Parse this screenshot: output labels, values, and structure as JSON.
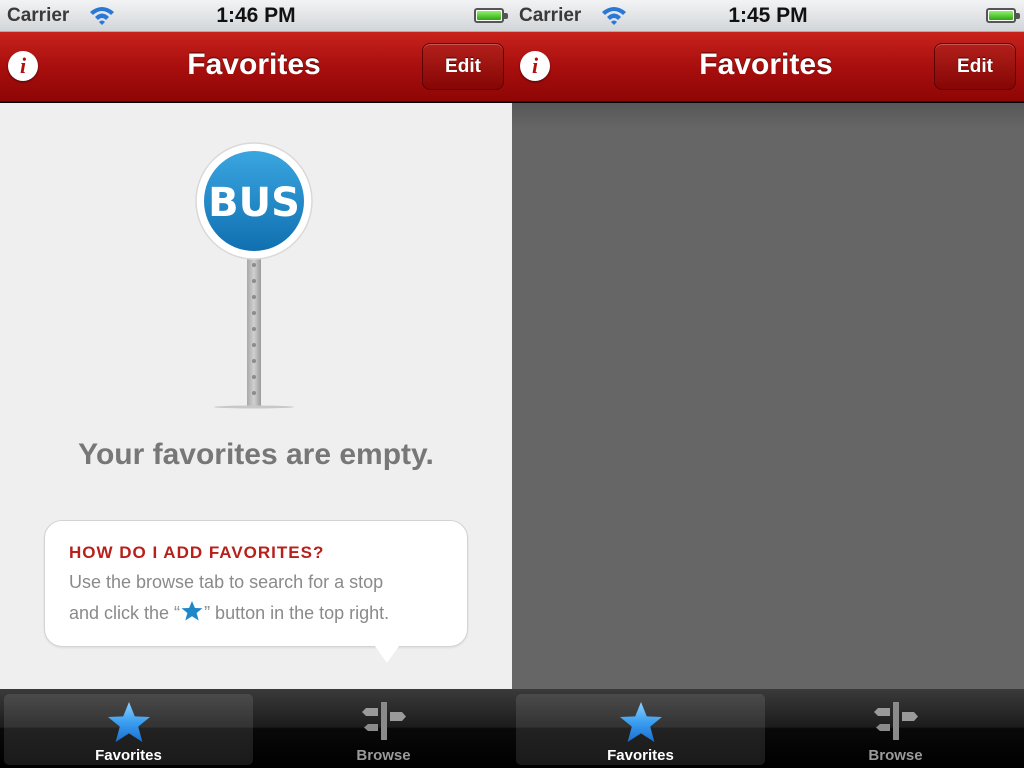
{
  "colors": {
    "navbar_red": "#a80f0e",
    "accent_red": "#b8201c",
    "bus_blue": "#1e8bc9",
    "star_blue": "#2a8fd8"
  },
  "screens": [
    {
      "status": {
        "carrier": "Carrier",
        "time": "1:46 PM"
      },
      "nav": {
        "title": "Favorites",
        "edit_label": "Edit",
        "info_icon": "info-icon"
      },
      "empty": {
        "sign_text": "BUS",
        "message": "Your favorites are empty.",
        "help_title": "HOW DO I ADD FAVORITES?",
        "help_line1": "Use the browse tab to search for a stop",
        "help_line2_before": "and click the “",
        "help_line2_after": "” button in the top right."
      },
      "tabs": [
        {
          "label": "Favorites",
          "icon": "star-icon",
          "selected": true
        },
        {
          "label": "Browse",
          "icon": "signpost-icon",
          "selected": false
        }
      ]
    },
    {
      "status": {
        "carrier": "Carrier",
        "time": "1:45 PM"
      },
      "nav": {
        "title": "Favorites",
        "edit_label": "Edit",
        "info_icon": "info-icon"
      },
      "tabs": [
        {
          "label": "Favorites",
          "icon": "star-icon",
          "selected": true
        },
        {
          "label": "Browse",
          "icon": "signpost-icon",
          "selected": false
        }
      ]
    }
  ]
}
